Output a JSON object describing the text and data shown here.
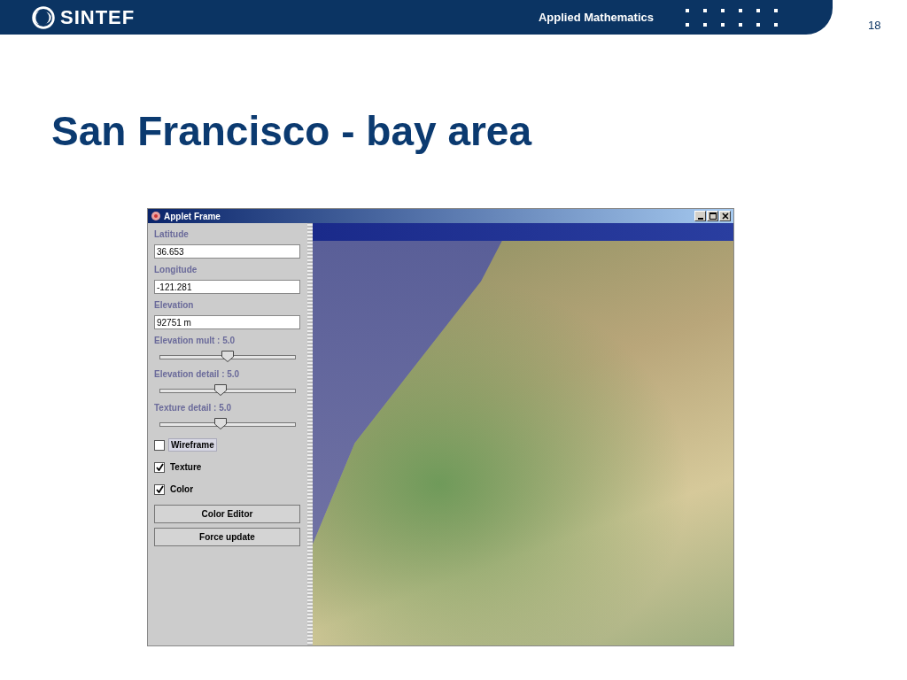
{
  "header": {
    "logo_text": "SINTEF",
    "department": "Applied Mathematics",
    "page_number": "18"
  },
  "title": "San Francisco - bay area",
  "window": {
    "title": "Applet Frame",
    "fields": [
      {
        "label": "Latitude",
        "value": "36.653"
      },
      {
        "label": "Longitude",
        "value": "-121.281"
      },
      {
        "label": "Elevation",
        "value": "92751 m"
      }
    ],
    "sliders": [
      {
        "label": "Elevation mult : 5.0",
        "level": 0.5
      },
      {
        "label": "Elevation detail : 5.0",
        "level": 0.45
      },
      {
        "label": "Texture detail : 5.0",
        "level": 0.45
      }
    ],
    "checkboxes": [
      {
        "label": "Wireframe",
        "checked": false,
        "focused": true
      },
      {
        "label": "Texture",
        "checked": true,
        "focused": false
      },
      {
        "label": "Color",
        "checked": true,
        "focused": false
      }
    ],
    "buttons": [
      "Color Editor",
      "Force update"
    ]
  }
}
